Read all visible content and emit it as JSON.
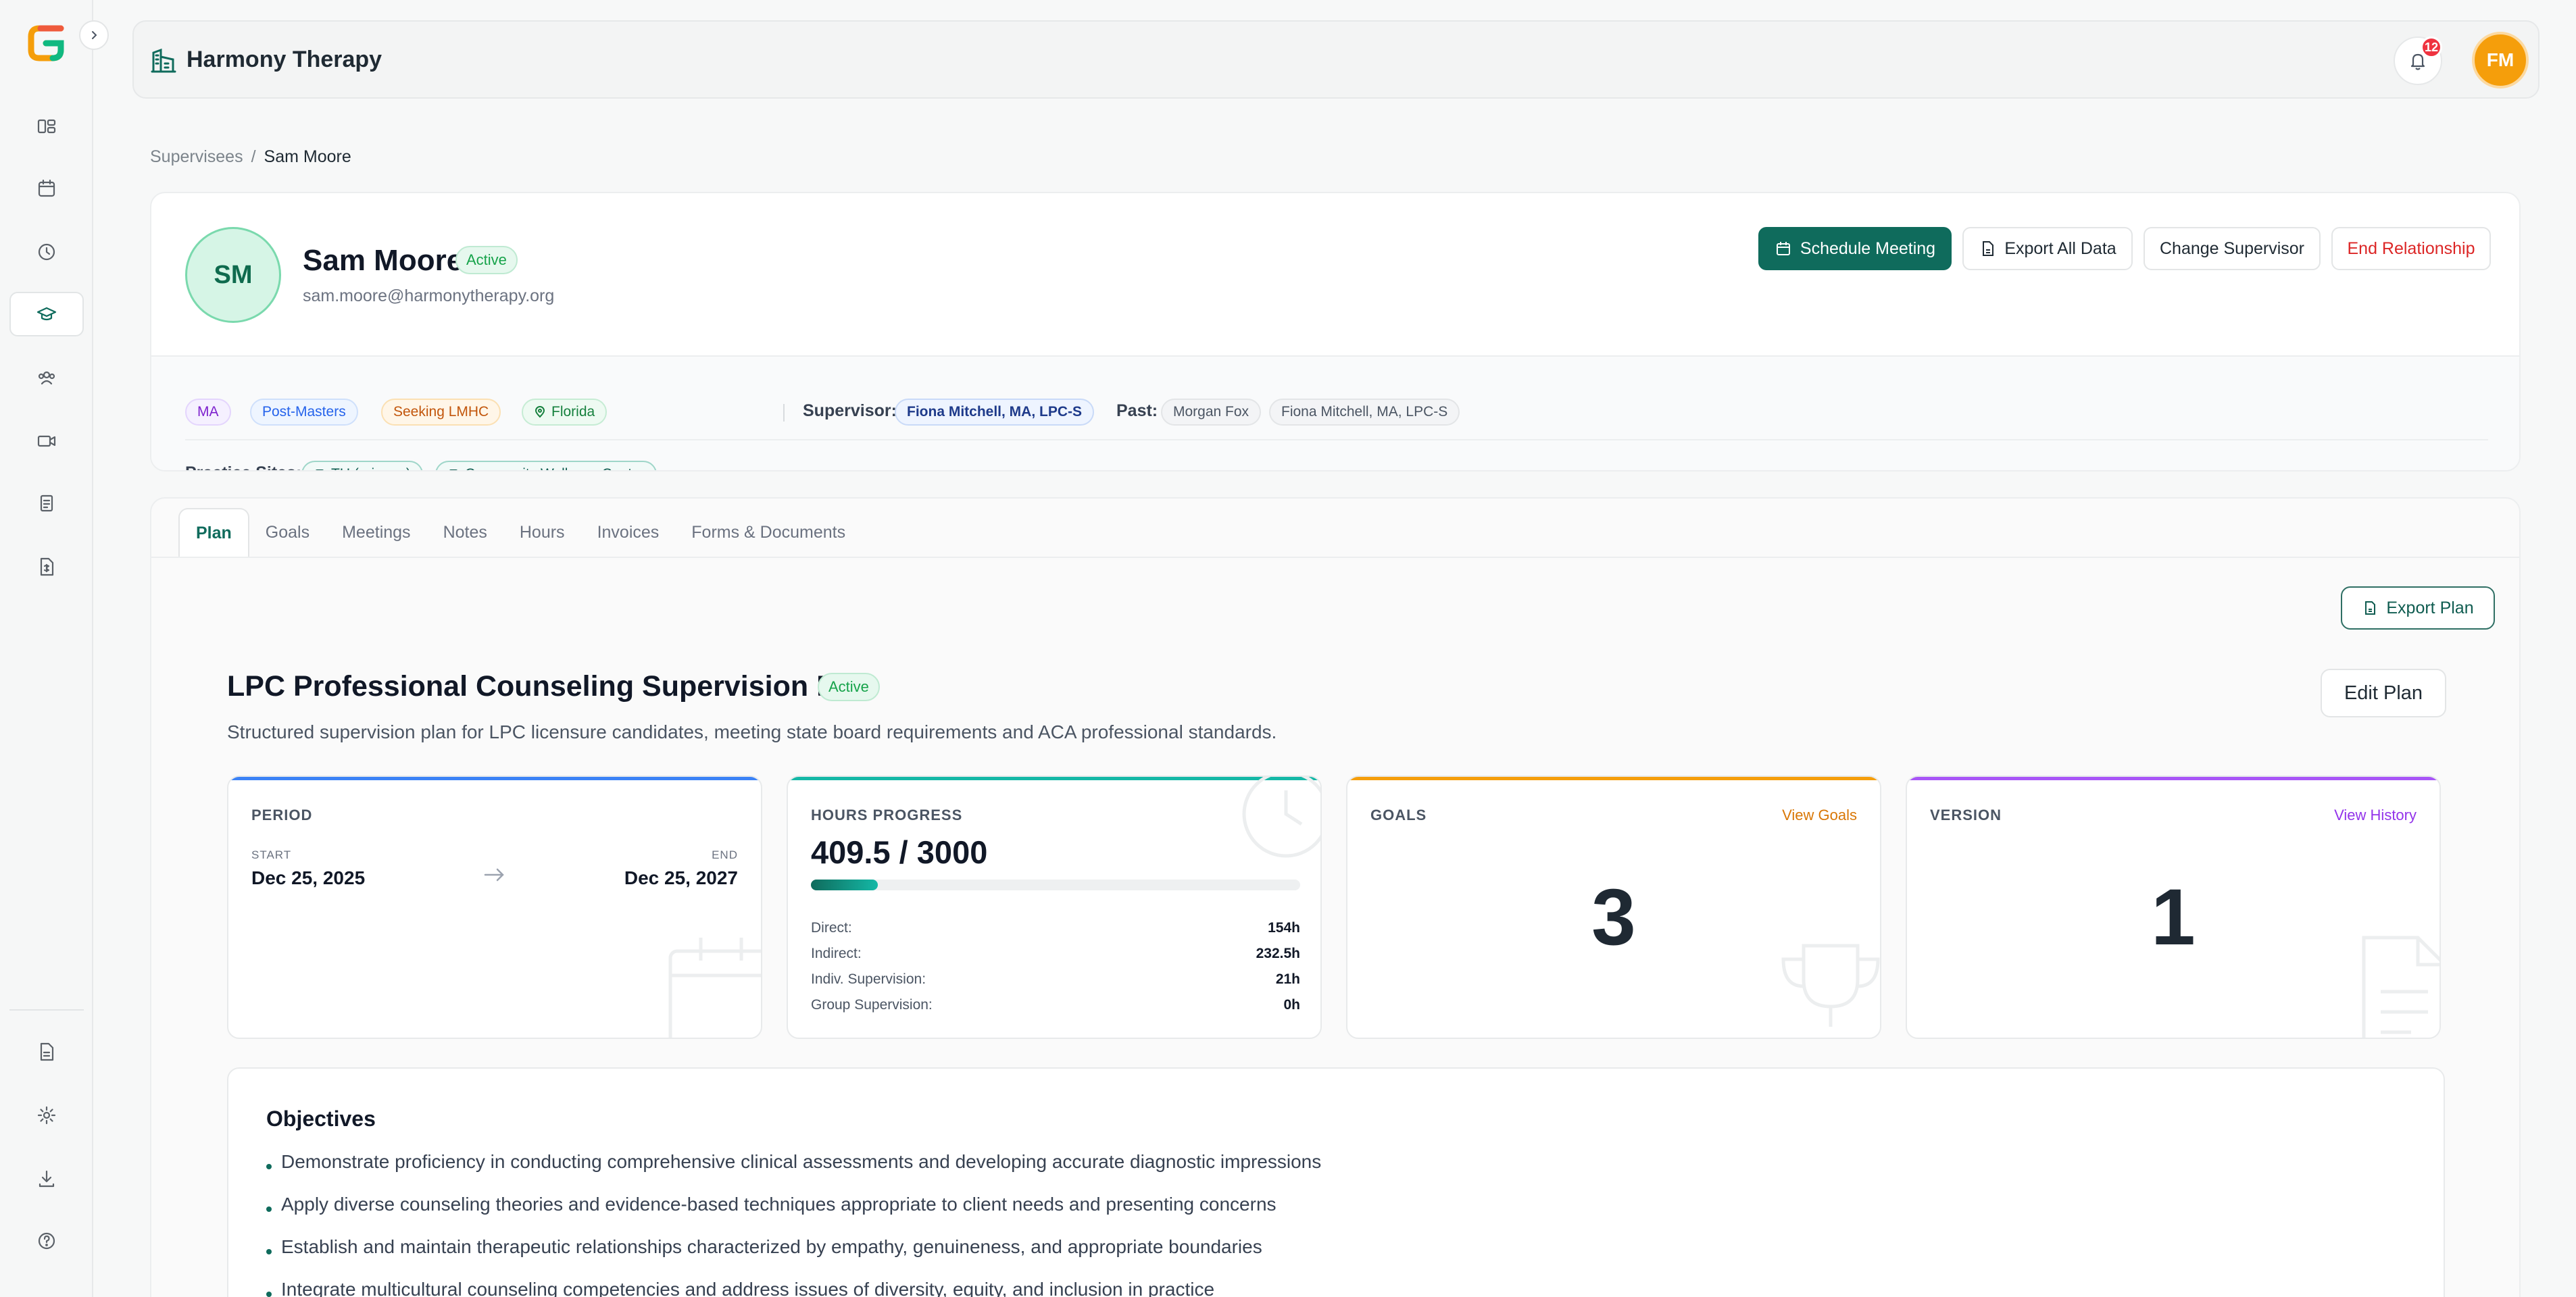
{
  "app": {
    "org_name": "Harmony Therapy",
    "notification_count": "12",
    "user_initials": "FM",
    "accent_color": "#0f6b5c"
  },
  "sidebar": {
    "icons": [
      "dashboard-icon",
      "calendar-icon",
      "clock-icon",
      "graduation-cap-icon",
      "users-icon",
      "video-icon",
      "clipboard-icon",
      "invoice-icon",
      "document-icon",
      "gear-icon",
      "download-icon",
      "help-icon"
    ],
    "active": "graduation-cap-icon"
  },
  "breadcrumb": {
    "parent": "Supervisees",
    "separator": "/",
    "current": "Sam Moore"
  },
  "profile": {
    "initials": "SM",
    "name": "Sam Moore",
    "status": "Active",
    "email": "sam.moore@harmonytherapy.org",
    "buttons": {
      "schedule": "Schedule Meeting",
      "export": "Export All Data",
      "change_supervisor": "Change Supervisor",
      "end": "End Relationship"
    },
    "tags": {
      "degree": "MA",
      "stage": "Post-Masters",
      "license": "Seeking LMHC",
      "state": "Florida"
    },
    "supervisor_label": "Supervisor:",
    "supervisor": "Fiona Mitchell, MA, LPC-S",
    "past_label": "Past:",
    "past": [
      "Morgan Fox",
      "Fiona Mitchell, MA, LPC-S"
    ],
    "sites_label": "Practice Sites:",
    "sites": [
      "TU (primary)",
      "Community Wellness Center"
    ]
  },
  "tabs": [
    "Plan",
    "Goals",
    "Meetings",
    "Notes",
    "Hours",
    "Invoices",
    "Forms & Documents"
  ],
  "plan": {
    "export_label": "Export Plan",
    "title": "LPC Professional Counseling Supervision Plan",
    "status": "Active",
    "edit_label": "Edit Plan",
    "description": "Structured supervision plan for LPC licensure candidates, meeting state board requirements and ACA professional standards.",
    "period": {
      "label": "PERIOD",
      "start_label": "START",
      "start": "Dec 25, 2025",
      "end_label": "END",
      "end": "Dec 25, 2027"
    },
    "hours": {
      "label": "HOURS PROGRESS",
      "summary": "409.5 / 3000",
      "progress_fraction": 0.1365,
      "rows": [
        {
          "label": "Direct:",
          "value": "154h"
        },
        {
          "label": "Indirect:",
          "value": "232.5h"
        },
        {
          "label": "Indiv. Supervision:",
          "value": "21h"
        },
        {
          "label": "Group Supervision:",
          "value": "0h"
        }
      ]
    },
    "goals": {
      "label": "GOALS",
      "link": "View Goals",
      "count": "3"
    },
    "version": {
      "label": "VERSION",
      "link": "View History",
      "number": "1"
    },
    "objectives_title": "Objectives",
    "objectives": [
      "Demonstrate proficiency in conducting comprehensive clinical assessments and developing accurate diagnostic impressions",
      "Apply diverse counseling theories and evidence-based techniques appropriate to client needs and presenting concerns",
      "Establish and maintain therapeutic relationships characterized by empathy, genuineness, and appropriate boundaries",
      "Integrate multicultural counseling competencies and address issues of diversity, equity, and inclusion in practice"
    ]
  }
}
